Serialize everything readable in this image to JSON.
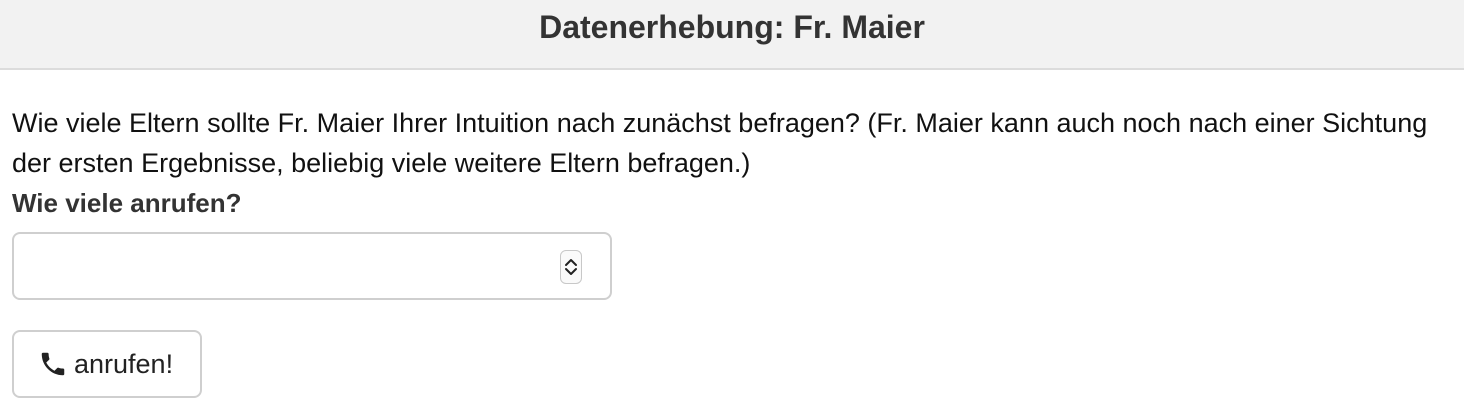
{
  "header": {
    "title": "Datenerhebung: Fr. Maier"
  },
  "main": {
    "question": "Wie viele Eltern sollte Fr. Maier Ihrer Intuition nach zunächst befragen? (Fr. Maier kann auch noch nach einer Sichtung der ersten Ergebnisse, beliebig viele weitere Eltern befragen.)",
    "input_label": "Wie viele anrufen?",
    "input_value": "",
    "call_button_label": "anrufen!",
    "call_button_icon": "phone-icon",
    "stepper_icons": [
      "chevron-up-icon",
      "chevron-down-icon"
    ]
  }
}
